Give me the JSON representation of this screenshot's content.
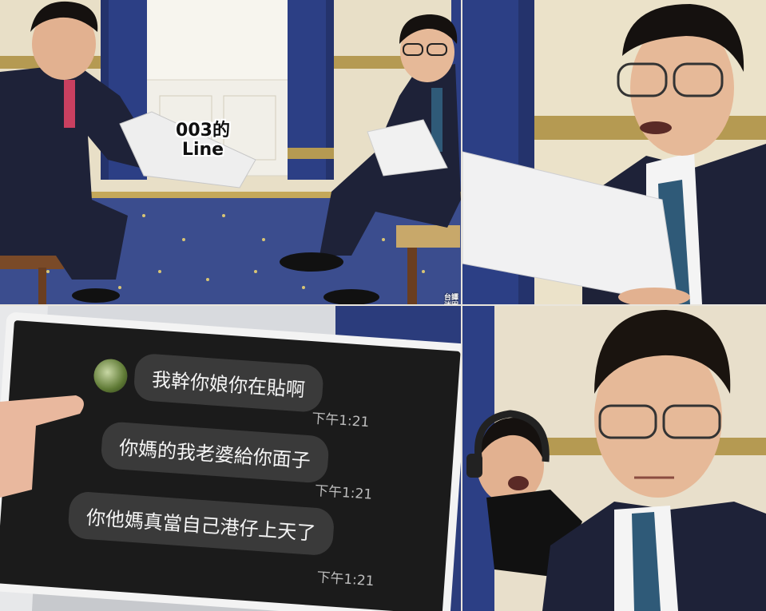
{
  "panel1": {
    "caption_line1": "003的",
    "caption_line2": "Line",
    "watermark_line1": "台譯",
    "watermark_line2": "迷因"
  },
  "chat": {
    "messages": [
      {
        "text": "我幹你娘你在貼啊",
        "time": "下午1:21"
      },
      {
        "text": "你媽的我老婆給你面子",
        "time": "下午1:21"
      },
      {
        "text": "你他媽真當自己港仔上天了",
        "time": "下午1:21"
      }
    ]
  },
  "colors": {
    "suit": "#1e2238",
    "tie": "#2f5a78",
    "carpet": "#3b4d8e",
    "curtain": "#2c3f85",
    "chat_bg": "#1b1b1b",
    "bubble": "#3a3a3a"
  }
}
